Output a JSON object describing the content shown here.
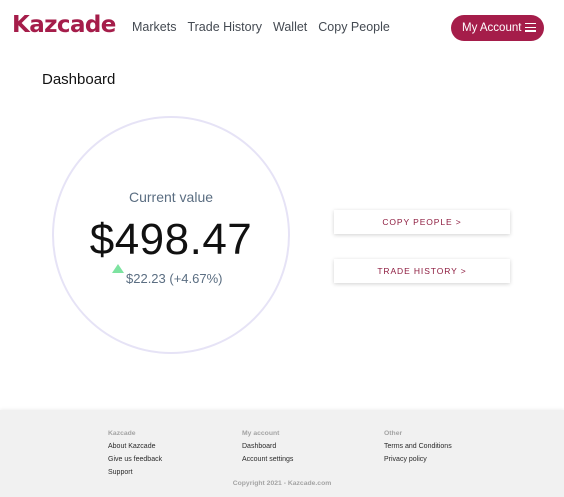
{
  "header": {
    "logo": "Kazcade",
    "nav": [
      "Markets",
      "Trade History",
      "Wallet",
      "Copy People"
    ],
    "account_label": "My Account",
    "account_icon": "menu-icon"
  },
  "main": {
    "title": "Dashboard",
    "current_value_label": "Current value",
    "current_value": "$498.47",
    "change_icon": "up-triangle-icon",
    "change": "$22.23 (+4.67%)",
    "actions": {
      "copy_people": "COPY PEOPLE >",
      "trade_history": "TRADE HISTORY >"
    }
  },
  "footer": {
    "columns": [
      {
        "heading": "Kazcade",
        "links": [
          "About Kazcade",
          "Give us feedback",
          "Support"
        ]
      },
      {
        "heading": "My account",
        "links": [
          "Dashboard",
          "Account settings"
        ]
      },
      {
        "heading": "Other",
        "links": [
          "Terms and Conditions",
          "Privacy policy"
        ]
      }
    ],
    "copyright": "Copyright 2021 - Kazcade.com"
  },
  "colors": {
    "brand": "#a51d4a",
    "positive": "#7de3a0",
    "circle_border": "#e6e3f6"
  }
}
